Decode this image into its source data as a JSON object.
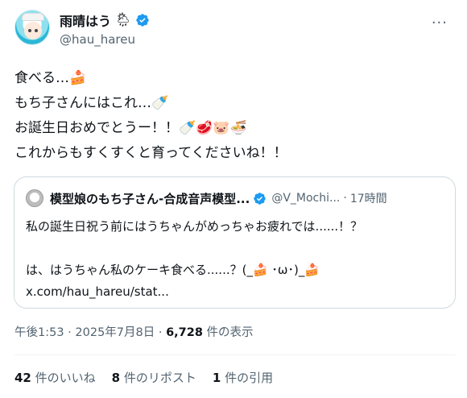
{
  "author": {
    "display_name": "雨晴はう",
    "status_emoji": "🌦",
    "handle": "@hau_hareu",
    "more_glyph": "···"
  },
  "tweet": {
    "lines": [
      "食べる…🍰",
      "もち子さんにはこれ…🍼",
      "お誕生日おめでとうー！！🍼🥩🐷🍜",
      "これからもすくすくと育ってくださいね！！"
    ]
  },
  "quote": {
    "name": "模型娘のもち子さん-合成音声模型...",
    "handle": "@V_Mochi...",
    "sep": "·",
    "time": "17時間",
    "lines": [
      "私の誕生日祝う前にはうちゃんがめっちゃお疲れでは......！？",
      "",
      "は、はうちゃん私のケーキ食べる......？(_🍰 ･ω･)_🍰",
      "x.com/hau_hareu/stat..."
    ]
  },
  "meta": {
    "timestamp": "午後1:53 · 2025年7月8日 · ",
    "views_count": "6,728",
    "views_label": " 件の表示"
  },
  "stats": {
    "likes_count": "42",
    "likes_label": " 件のいいね",
    "reposts_count": "8",
    "reposts_label": " 件のリポスト",
    "quotes_count": "1",
    "quotes_label": "件の引用"
  },
  "colors": {
    "verified": "#1d9bf0",
    "text": "#0f1419",
    "secondary": "#536471",
    "border": "#cfd9de"
  }
}
